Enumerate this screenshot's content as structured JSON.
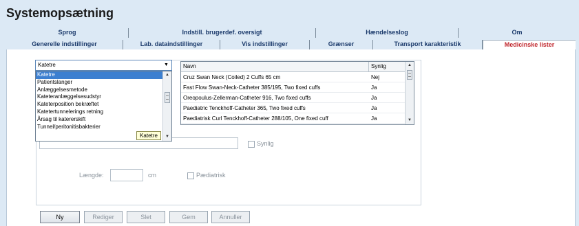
{
  "title": "Systemopsætning",
  "tabs_row1": [
    "Sprog",
    "Indstill. brugerdef. oversigt",
    "Hændelseslog",
    "Om"
  ],
  "tabs_row2": [
    "Generelle indstillinger",
    "Lab. dataindstillinger",
    "Vis indstillinger",
    "Grænser",
    "Transport karakteristik",
    "Medicinske lister"
  ],
  "active_tab": "Medicinske lister",
  "category_select": {
    "value": "Katetre",
    "options": [
      "Katetre",
      "Patientslanger",
      "Anlæggelsesmetode",
      "Kateteranlæggelsesudstyr",
      "Kateterposition bekræftet",
      "Katetertunnelerings retning",
      "Årsag til katererskift",
      "Tunnel/peritonitisbakterier"
    ]
  },
  "tooltip": "Katetre",
  "table": {
    "columns": [
      "Navn",
      "Synlig"
    ],
    "rows": [
      [
        "Cruz Swan Neck (Coiled) 2 Cuffs 65 cm",
        "Nej"
      ],
      [
        "Fast Flow Swan-Neck-Catheter 385/195, Two fixed cuffs",
        "Ja"
      ],
      [
        "Oreopoulus-Zellerman-Catheter 916, Two fixed cuffs",
        "Ja"
      ],
      [
        "Paediatric Tenckhoff-Catheter 365, Two fixed cuffs",
        "Ja"
      ],
      [
        "Paediatrisk Curl Tenckhoff-Catheter 288/105, One fixed cuff",
        "Ja"
      ]
    ]
  },
  "form": {
    "name_value": "",
    "synlig_label": "Synlig",
    "length_label": "Længde:",
    "length_value": "",
    "length_unit": "cm",
    "paediatric_label": "Pædiatrisk"
  },
  "buttons": {
    "new": "Ny",
    "edit": "Rediger",
    "delete": "Slet",
    "save": "Gem",
    "cancel": "Annuller"
  }
}
